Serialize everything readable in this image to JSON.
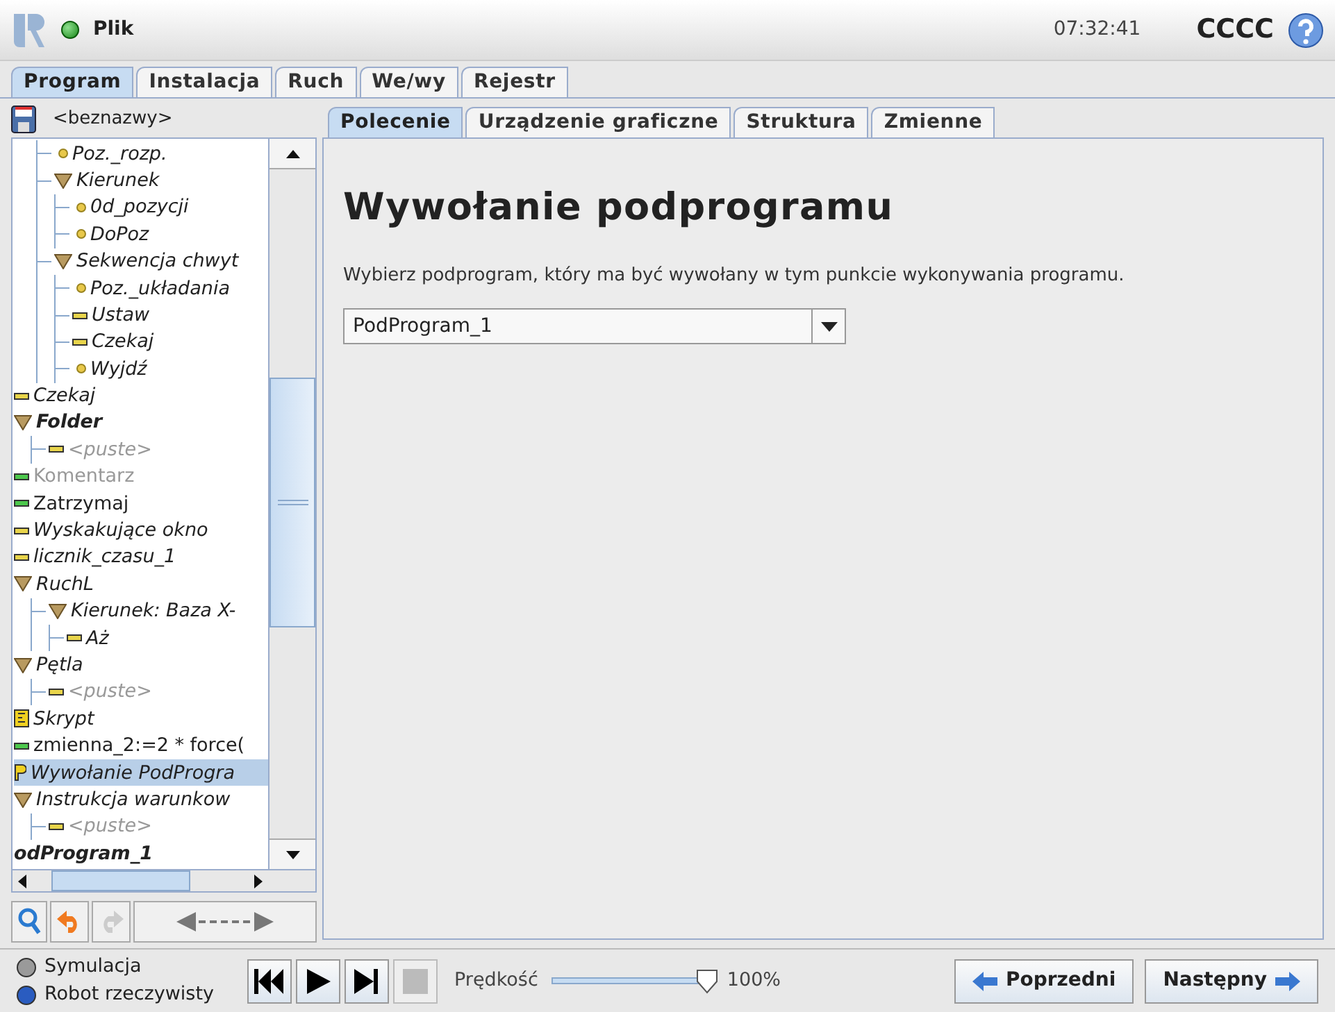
{
  "title_bar": {
    "menu": "Plik",
    "time": "07:32:41",
    "robot_name": "CCCC"
  },
  "main_tabs": [
    {
      "label": "Program",
      "selected": true
    },
    {
      "label": "Instalacja",
      "selected": false
    },
    {
      "label": "Ruch",
      "selected": false
    },
    {
      "label": "We/wy",
      "selected": false
    },
    {
      "label": "Rejestr",
      "selected": false
    }
  ],
  "program_name": "<beznazwy>",
  "tree": {
    "items": [
      {
        "children": [
          {
            "kind": "waypoint",
            "label": "Poz._rozp.",
            "italic": true,
            "selected": false
          },
          {
            "kind": "group",
            "label": "Kierunek",
            "italic": true,
            "selected": false,
            "children": [
              {
                "kind": "waypoint",
                "label": "0d_pozycji",
                "italic": true,
                "selected": false
              },
              {
                "kind": "waypoint",
                "label": "DoPoz",
                "italic": true,
                "selected": false
              }
            ]
          },
          {
            "kind": "group",
            "label": "Sekwencja chwyt",
            "italic": true,
            "selected": false,
            "children": [
              {
                "kind": "waypoint",
                "label": "Poz._układania",
                "italic": true,
                "selected": false
              },
              {
                "kind": "command",
                "color": "#e8d44a",
                "label": "Ustaw",
                "italic": true,
                "selected": false
              },
              {
                "kind": "command",
                "color": "#e8d44a",
                "label": "Czekaj",
                "italic": true,
                "selected": false
              },
              {
                "kind": "waypoint",
                "label": "Wyjdź",
                "italic": true,
                "selected": false
              }
            ]
          }
        ]
      },
      {
        "kind": "command",
        "color": "#e8d44a",
        "label": "Czekaj",
        "italic": true,
        "selected": false
      },
      {
        "kind": "group",
        "label": "Folder",
        "italic": true,
        "bold": true,
        "selected": false,
        "children": [
          {
            "kind": "command",
            "color": "#e8d44a",
            "label": "<puste>",
            "italic": true,
            "disabled": true,
            "selected": false
          }
        ]
      },
      {
        "kind": "command",
        "color": "#4cc84c",
        "label": "Komentarz",
        "disabled": true,
        "selected": false
      },
      {
        "kind": "command",
        "color": "#4cc84c",
        "label": "Zatrzymaj",
        "selected": false
      },
      {
        "kind": "command",
        "color": "#e8d44a",
        "label": "Wyskakujące okno",
        "italic": true,
        "selected": false
      },
      {
        "kind": "command",
        "color": "#e8d44a",
        "label": "licznik_czasu_1",
        "italic": true,
        "selected": false
      },
      {
        "kind": "group",
        "label": "RuchL",
        "italic": true,
        "selected": false,
        "children": [
          {
            "kind": "group",
            "label": "Kierunek: Baza X-",
            "italic": true,
            "selected": false,
            "children": [
              {
                "kind": "command",
                "color": "#e8d44a",
                "label": "Aż",
                "italic": true,
                "selected": false
              }
            ]
          }
        ]
      },
      {
        "kind": "group",
        "label": "Pętla",
        "italic": true,
        "selected": false,
        "children": [
          {
            "kind": "command",
            "color": "#e8d44a",
            "label": "<puste>",
            "italic": true,
            "disabled": true,
            "selected": false
          }
        ]
      },
      {
        "kind": "script",
        "label": "Skrypt",
        "italic": true,
        "selected": false
      },
      {
        "kind": "command",
        "color": "#4cc84c",
        "label": "zmienna_2:=2 * force(",
        "selected": false
      },
      {
        "kind": "call",
        "label": "Wywołanie PodProgra",
        "italic": true,
        "selected": true
      },
      {
        "kind": "group",
        "label": "Instrukcja warunkow",
        "italic": true,
        "selected": false,
        "children": [
          {
            "kind": "command",
            "color": "#e8d44a",
            "label": "<puste>",
            "italic": true,
            "disabled": true,
            "selected": false
          }
        ]
      },
      {
        "kind": "subprogram",
        "label": "odProgram_1",
        "italic": true,
        "bold": true,
        "selected": false
      }
    ]
  },
  "sub_tabs": [
    {
      "label": "Polecenie",
      "selected": true
    },
    {
      "label": "Urządzenie graficzne",
      "selected": false
    },
    {
      "label": "Struktura",
      "selected": false
    },
    {
      "label": "Zmienne",
      "selected": false
    }
  ],
  "content": {
    "heading": "Wywołanie podprogramu",
    "description": "Wybierz podprogram, który ma być wywołany w tym punkcie wykonywania programu.",
    "subprogram_select": {
      "value": "PodProgram_1"
    }
  },
  "bottom": {
    "modes": [
      {
        "label": "Symulacja",
        "selected": false
      },
      {
        "label": "Robot rzeczywisty",
        "selected": true
      }
    ],
    "speed": {
      "label": "Prędkość",
      "level": 1,
      "reading": "100%"
    },
    "prev": "Poprzedni",
    "next": "Następny"
  }
}
